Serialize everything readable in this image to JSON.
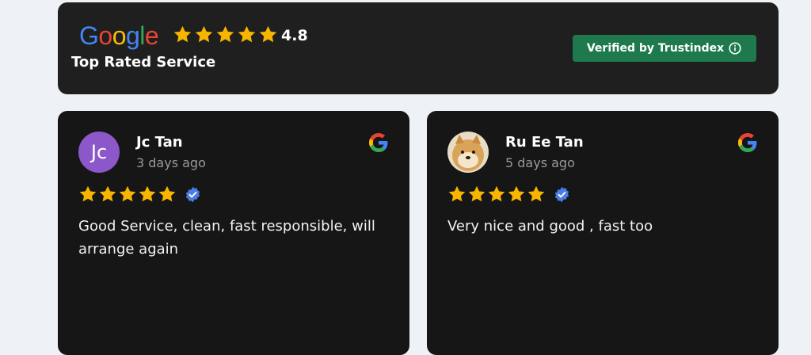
{
  "header": {
    "logo_text": "Google",
    "logo_letters": [
      {
        "char": "G",
        "color": "#4285F4"
      },
      {
        "char": "o",
        "color": "#EA4335"
      },
      {
        "char": "o",
        "color": "#FBBC05"
      },
      {
        "char": "g",
        "color": "#4285F4"
      },
      {
        "char": "l",
        "color": "#34A853"
      },
      {
        "char": "e",
        "color": "#EA4335"
      }
    ],
    "stars": 5,
    "rating": "4.8",
    "subtitle": "Top Rated Service",
    "verified_label": "Verified by Trustindex",
    "verified_icon": "info-circle-icon"
  },
  "colors": {
    "card_bg": "#161616",
    "header_bg": "#1f1f1f",
    "star": "#f7b500",
    "verified_bg": "#1e7a4d",
    "verified_check": "#4a7de8"
  },
  "reviews": [
    {
      "avatar_initials": "Jc",
      "avatar_type": "initials",
      "name": "Jc Tan",
      "date": "3 days ago",
      "stars": 5,
      "source_icon": "google-g-icon",
      "verified_icon": "verified-check-icon",
      "text": "Good Service, clean, fast responsible, will arrange again"
    },
    {
      "avatar_type": "photo",
      "avatar_icon": "shiba-dog-avatar-icon",
      "name": "Ru Ee Tan",
      "date": "5 days ago",
      "stars": 5,
      "source_icon": "google-g-icon",
      "verified_icon": "verified-check-icon",
      "text": "Very nice and good , fast too"
    }
  ]
}
